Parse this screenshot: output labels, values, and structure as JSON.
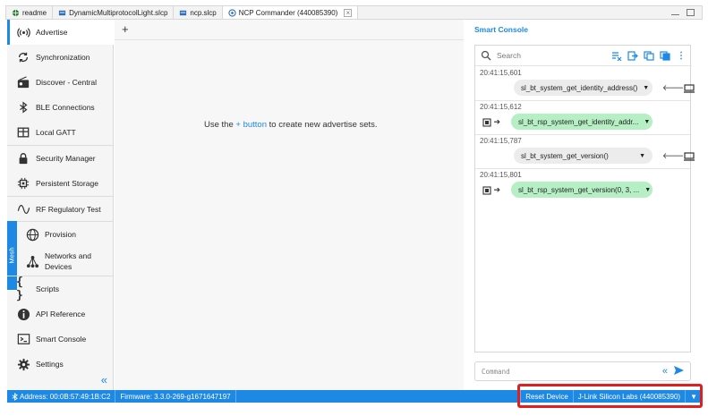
{
  "tabs": [
    {
      "label": "readme",
      "icon": "globe-icon"
    },
    {
      "label": "DynamicMultiprotocolLight.slcp",
      "icon": "project-icon"
    },
    {
      "label": "ncp.slcp",
      "icon": "project-icon"
    },
    {
      "label": "NCP Commander (440085390)",
      "icon": "commander-icon",
      "active": true
    }
  ],
  "sidebar": {
    "items": [
      {
        "label": "Advertise",
        "icon": "broadcast-icon",
        "active": true
      },
      {
        "label": "Synchronization",
        "icon": "sync-icon"
      },
      {
        "label": "Discover - Central",
        "icon": "radio-icon"
      },
      {
        "label": "BLE Connections",
        "icon": "bluetooth-icon"
      },
      {
        "label": "Local GATT",
        "icon": "table-icon"
      },
      {
        "label": "Security Manager",
        "icon": "lock-icon"
      },
      {
        "label": "Persistent Storage",
        "icon": "chip-icon"
      },
      {
        "label": "RF Regulatory Test",
        "icon": "wave-icon"
      },
      {
        "label": "Provision",
        "icon": "globe-icon"
      },
      {
        "label": "Networks and Devices",
        "icon": "network-icon"
      },
      {
        "label": "Scripts",
        "icon": "braces-icon"
      },
      {
        "label": "API Reference",
        "icon": "info-icon"
      },
      {
        "label": "Smart Console",
        "icon": "terminal-icon"
      },
      {
        "label": "Settings",
        "icon": "gear-icon"
      }
    ],
    "mesh_label": "Mesh",
    "collapse_glyph": "«"
  },
  "main": {
    "add_tab": "+",
    "hint_prefix": "Use the",
    "hint_link": "+ button",
    "hint_suffix": "to create new advertise sets."
  },
  "console": {
    "title": "Smart Console",
    "search_placeholder": "Search",
    "entries": [
      {
        "time": "20:41:15,601",
        "text": "sl_bt_system_get_identity_address()",
        "direction": "out"
      },
      {
        "time": "20:41:15,612",
        "text": "sl_bt_rsp_system_get_identity_addr...",
        "direction": "in"
      },
      {
        "time": "20:41:15,787",
        "text": "sl_bt_system_get_version()",
        "direction": "out"
      },
      {
        "time": "20:41:15,801",
        "text": "sl_bt_rsp_system_get_version(0, 3, ...",
        "direction": "in"
      }
    ],
    "command_placeholder": "Command",
    "accent": "#1e88e5",
    "response_color": "#b7efc5"
  },
  "status": {
    "address": "Address: 00:0B:57:49:1B:C2",
    "firmware": "Firmware: 3.3.0-269-g1671647197",
    "reset": "Reset Device",
    "jlink": "J-Link Silicon Labs (440085390)",
    "bar_color": "#1e88e5"
  }
}
